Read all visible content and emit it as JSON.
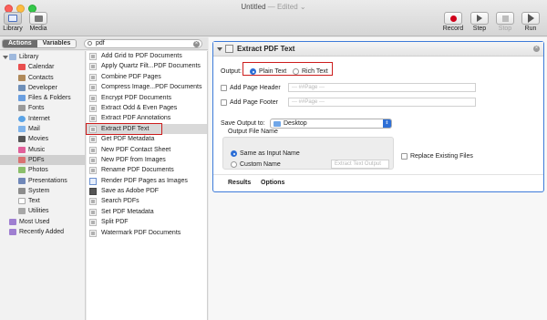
{
  "window": {
    "title": "Untitled",
    "edited": "— Edited ⌄"
  },
  "toolbar": {
    "library": "Library",
    "media": "Media",
    "record": "Record",
    "step": "Step",
    "stop": "Stop",
    "run": "Run"
  },
  "library_header": {
    "actions_tab": "Actions",
    "variables_tab": "Variables",
    "search_value": "pdf"
  },
  "categories": {
    "library": "Library",
    "calendar": "Calendar",
    "contacts": "Contacts",
    "developer": "Developer",
    "files_folders": "Files & Folders",
    "fonts": "Fonts",
    "internet": "Internet",
    "mail": "Mail",
    "movies": "Movies",
    "music": "Music",
    "pdfs": "PDFs",
    "photos": "Photos",
    "presentations": "Presentations",
    "system": "System",
    "text": "Text",
    "utilities": "Utilities",
    "most_used": "Most Used",
    "recently_added": "Recently Added"
  },
  "actions": {
    "a0": "Add Grid to PDF Documents",
    "a1": "Apply Quartz Filt...PDF Documents",
    "a2": "Combine PDF Pages",
    "a3": "Compress Image...PDF Documents",
    "a4": "Encrypt PDF Documents",
    "a5": "Extract Odd & Even Pages",
    "a6": "Extract PDF Annotations",
    "a7": "Extract PDF Text",
    "a8": "Get PDF Metadata",
    "a9": "New PDF Contact Sheet",
    "a10": "New PDF from Images",
    "a11": "Rename PDF Documents",
    "a12": "Render PDF Pages as Images",
    "a13": "Save as Adobe PDF",
    "a14": "Search PDFs",
    "a15": "Set PDF Metadata",
    "a16": "Split PDF",
    "a17": "Watermark PDF Documents"
  },
  "action_card": {
    "title": "Extract PDF Text",
    "output_label": "Output:",
    "plain_text": "Plain Text",
    "rich_text": "Rich Text",
    "add_header": "Add Page Header",
    "header_placeholder": "--- ##Page ---",
    "add_footer": "Add Page Footer",
    "footer_placeholder": "--- ##Page ---",
    "save_output_label": "Save Output to:",
    "save_output_value": "Desktop",
    "output_file_name": "Output File Name",
    "same_as_input": "Same as Input Name",
    "custom_name": "Custom Name",
    "custom_placeholder": "Extract Text Output",
    "replace_existing": "Replace Existing Files",
    "results_tab": "Results",
    "options_tab": "Options"
  },
  "colors": {
    "accent": "#2d6fd6",
    "highlight_box": "#cc1d1d",
    "record": "#d0021b"
  }
}
